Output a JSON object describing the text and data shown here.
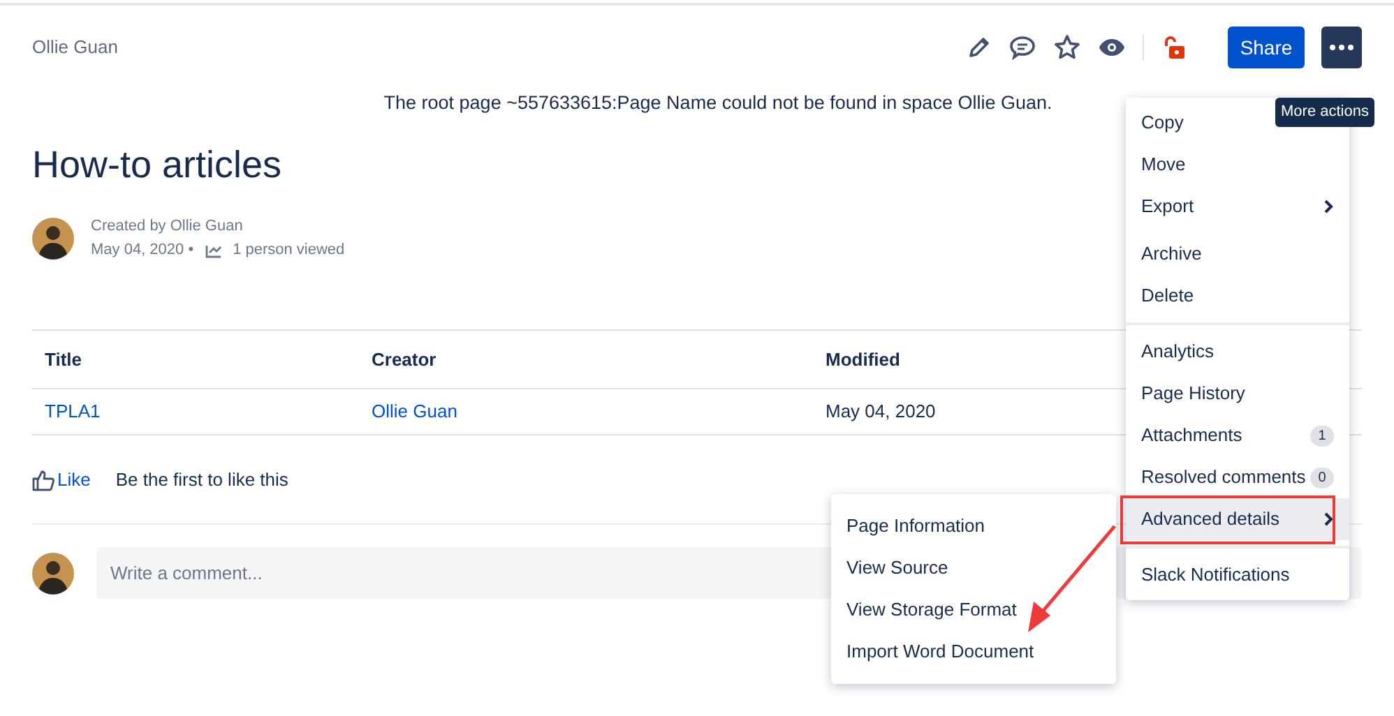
{
  "breadcrumb": "Ollie Guan",
  "toolbar": {
    "share_button": "Share",
    "tooltip": "More actions"
  },
  "notice": "The root page ~557633615:Page Name could not be found in space Ollie Guan.",
  "title": "How-to articles",
  "byline": {
    "created_by": "Created by Ollie Guan",
    "date": "May 04, 2020 •",
    "views": "1 person viewed"
  },
  "table": {
    "columns": [
      "Title",
      "Creator",
      "Modified"
    ],
    "rows": [
      [
        "TPLA1",
        "Ollie Guan",
        "May 04, 2020"
      ]
    ]
  },
  "like": {
    "button": "Like",
    "text": "Be the first to like this"
  },
  "comment": {
    "placeholder": "Write a comment..."
  },
  "more_menu": {
    "groups": [
      {
        "items": [
          {
            "label": "Copy",
            "selected": false
          },
          {
            "label": "Move",
            "selected": false
          },
          {
            "label": "Export",
            "selected": false,
            "submenu": true
          },
          {
            "label": "Archive",
            "selected": false
          },
          {
            "label": "Delete",
            "selected": false
          }
        ]
      },
      {
        "items": [
          {
            "label": "Analytics",
            "selected": false
          },
          {
            "label": "Page History",
            "selected": false
          },
          {
            "label": "Attachments",
            "selected": false,
            "badge": "1"
          },
          {
            "label": "Resolved comments",
            "selected": false,
            "badge": "0"
          },
          {
            "label": "Advanced details",
            "selected": true,
            "submenu": true,
            "annotated": true
          }
        ]
      },
      {
        "items": [
          {
            "label": "Slack Notifications",
            "selected": false
          }
        ]
      }
    ]
  },
  "submenu": {
    "items": [
      "Page Information",
      "View Source",
      "View Storage Format",
      "Import Word Document"
    ]
  }
}
